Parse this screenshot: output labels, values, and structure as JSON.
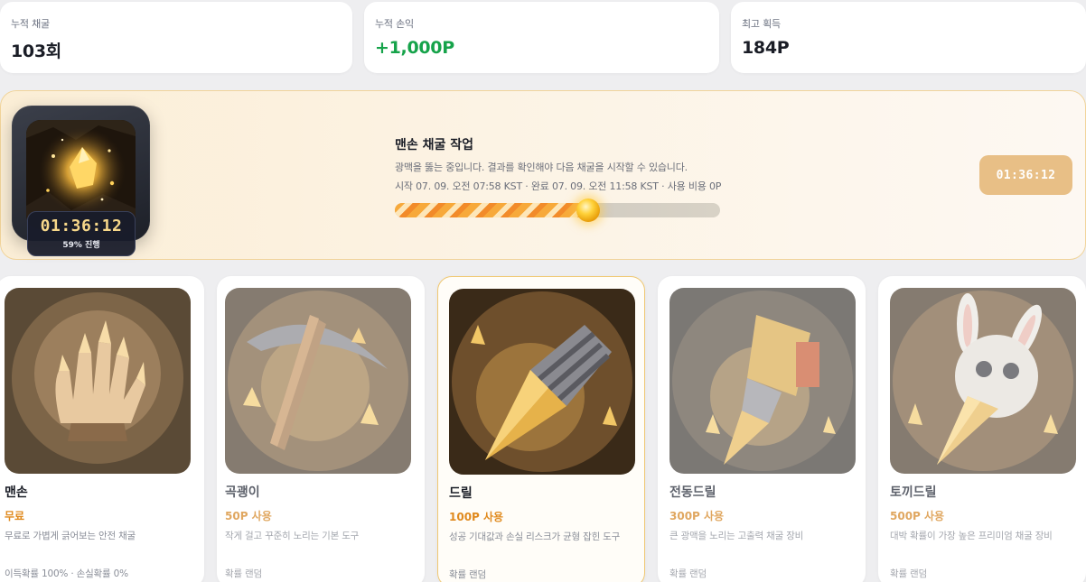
{
  "stats": [
    {
      "label": "누적 채굴",
      "value": "103회",
      "positive": false
    },
    {
      "label": "누적 손익",
      "value": "+1,000P",
      "positive": true
    },
    {
      "label": "최고 획득",
      "value": "184P",
      "positive": false
    }
  ],
  "job": {
    "title": "맨손 채굴 작업",
    "description": "광맥을 뚫는 중입니다. 결과를 확인해야 다음 채굴을 시작할 수 있습니다.",
    "meta": "시작 07. 09. 오전 07:58 KST · 완료 07. 09. 오전 11:58 KST · 사용 비용 0P",
    "timer": "01:36:12",
    "progress_text": "59% 진행",
    "progress": 0.59,
    "timer_button": "01:36:12",
    "thumb_icon": "gold-ore-icon"
  },
  "tools": [
    {
      "name": "맨손",
      "price": "무료",
      "description": "무료로 가볍게 긁어보는 안전 채굴",
      "odds": "이득확률 100% · 손실확률 0%",
      "icon": "gloved-hand-icon",
      "state": "active"
    },
    {
      "name": "곡괭이",
      "price": "50P 사용",
      "description": "작게 걸고 꾸준히 노리는 기본 도구",
      "odds": "확률 랜덤",
      "icon": "pickaxe-icon",
      "state": "dimmed"
    },
    {
      "name": "드릴",
      "price": "100P 사용",
      "description": "성공 기대값과 손실 리스크가 균형 잡힌 도구",
      "odds": "확률 랜덤",
      "icon": "drill-icon",
      "state": "selected"
    },
    {
      "name": "전동드릴",
      "price": "300P 사용",
      "description": "큰 광맥을 노리는 고출력 채굴 장비",
      "odds": "확률 랜덤",
      "icon": "power-drill-icon",
      "state": "dimmed"
    },
    {
      "name": "토끼드릴",
      "price": "500P 사용",
      "description": "대박 확률이 가장 높은 프리미엄 채굴 장비",
      "odds": "확률 랜덤",
      "icon": "rabbit-drill-icon",
      "state": "dimmed"
    }
  ]
}
